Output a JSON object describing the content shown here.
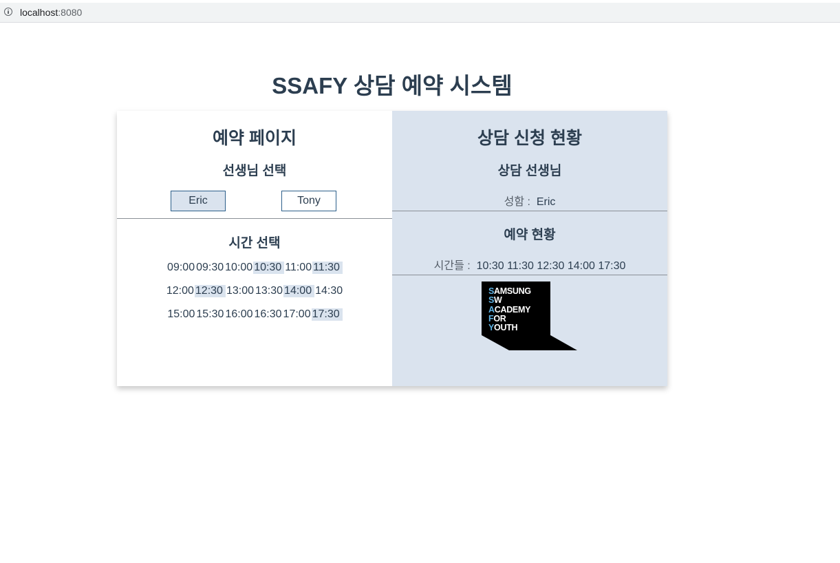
{
  "browser": {
    "host": "localhost",
    "port": ":8080"
  },
  "title": "SSAFY 상담 예약 시스템",
  "left": {
    "heading": "예약 페이지",
    "teacher_heading": "선생님 선택",
    "teachers": [
      {
        "label": "Eric",
        "selected": true
      },
      {
        "label": "Tony",
        "selected": false
      }
    ],
    "time_heading": "시간 선택",
    "time_rows": [
      [
        {
          "t": "09:00",
          "b": false
        },
        {
          "t": "09:30",
          "b": false
        },
        {
          "t": "10:00",
          "b": false
        },
        {
          "t": "10:30",
          "b": true
        },
        {
          "t": "11:00",
          "b": false
        },
        {
          "t": "11:30",
          "b": true
        }
      ],
      [
        {
          "t": "12:00",
          "b": false
        },
        {
          "t": "12:30",
          "b": true
        },
        {
          "t": "13:00",
          "b": false
        },
        {
          "t": "13:30",
          "b": false
        },
        {
          "t": "14:00",
          "b": true
        },
        {
          "t": "14:30",
          "b": false
        }
      ],
      [
        {
          "t": "15:00",
          "b": false
        },
        {
          "t": "15:30",
          "b": false
        },
        {
          "t": "16:00",
          "b": false
        },
        {
          "t": "16:30",
          "b": false
        },
        {
          "t": "17:00",
          "b": false
        },
        {
          "t": "17:30",
          "b": true
        }
      ]
    ]
  },
  "right": {
    "heading": "상담 신청 현황",
    "teacher_heading": "상담 선생님",
    "name_label": "성함 :",
    "name_value": "Eric",
    "status_heading": "예약 현황",
    "times_label": "시간들 :",
    "times_value": "10:30 11:30 12:30 14:00 17:30"
  },
  "logo": {
    "lines": [
      {
        "first": "S",
        "rest": "AMSUNG"
      },
      {
        "first": "S",
        "rest": "W"
      },
      {
        "first": "A",
        "rest": "CADEMY"
      },
      {
        "first": "F",
        "rest": "OR"
      },
      {
        "first": "Y",
        "rest": "OUTH"
      }
    ]
  },
  "colors": {
    "accent": "#dae3ee",
    "text": "#2c3e50",
    "border": "#2c5f8a",
    "logo_highlight": "#5eb3e4"
  }
}
